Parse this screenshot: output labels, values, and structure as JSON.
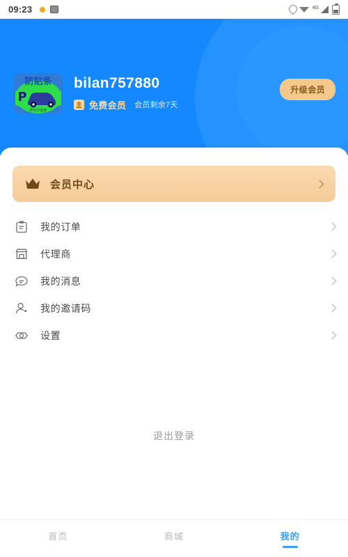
{
  "status_bar": {
    "time": "09:23",
    "left_icons": [
      "dot-indicator-icon",
      "screenshot-icon"
    ],
    "right_icons": [
      "location-icon",
      "wifi-icon",
      "signal-icon",
      "battery-icon"
    ],
    "network_label": "4G"
  },
  "header": {
    "background_color": "#1489FF",
    "accent_color": "#2492FF",
    "avatar": {
      "name": "app-logo-avatar",
      "brand_text": "防贴条",
      "sub_text": "停车不贴条",
      "letter": "P"
    },
    "username": "bilan757880",
    "member_level": "免费会员",
    "member_remaining": "会员剩余7天",
    "upgrade_button": "升级会员"
  },
  "vip_card": {
    "label": "会员中心",
    "icon": "crown-icon",
    "accent_color": "#F7CB99",
    "text_color": "#6E4A18"
  },
  "menu": {
    "items": [
      {
        "label": "我的订单",
        "icon": "clipboard-icon",
        "key": "my-orders"
      },
      {
        "label": "代理商",
        "icon": "store-icon",
        "key": "agent"
      },
      {
        "label": "我的消息",
        "icon": "message-icon",
        "key": "my-messages"
      },
      {
        "label": "我的邀请码",
        "icon": "user-add-icon",
        "key": "my-invite-code"
      },
      {
        "label": "设置",
        "icon": "eye-icon",
        "key": "settings"
      }
    ]
  },
  "logout": {
    "label": "退出登录"
  },
  "tabbar": {
    "active_color": "#3B9DF8",
    "inactive_color": "#b8b8b8",
    "tabs": [
      {
        "label": "首页",
        "key": "home",
        "active": false
      },
      {
        "label": "商城",
        "key": "store",
        "active": false
      },
      {
        "label": "我的",
        "key": "mine",
        "active": true
      }
    ]
  }
}
